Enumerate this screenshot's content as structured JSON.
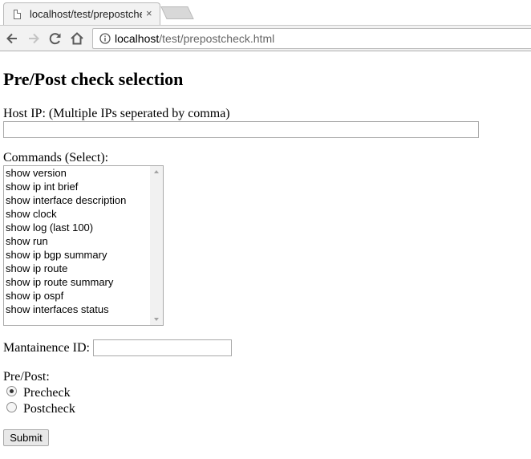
{
  "browser": {
    "tab_title": "localhost/test/prepostche",
    "tab_close": "×",
    "url_host": "localhost",
    "url_path": "/test/prepostcheck.html",
    "icons": [
      "page-icon",
      "back-arrow-icon",
      "forward-arrow-icon",
      "reload-icon",
      "home-icon",
      "info-icon"
    ]
  },
  "page": {
    "title": "Pre/Post check selection",
    "host_ip_label": "Host IP: (Multiple IPs seperated by comma)",
    "host_ip_value": "",
    "commands_label": "Commands (Select):",
    "commands": [
      "show version",
      "show ip int brief",
      "show interface description",
      "show clock",
      "show log (last 100)",
      "show run",
      "show ip bgp summary",
      "show ip route",
      "show ip route summary",
      "show ip ospf",
      "show interfaces status"
    ],
    "maintenance_label": "Mantainence ID:",
    "maintenance_value": "",
    "prepost_label": "Pre/Post:",
    "precheck_label": "Precheck",
    "postcheck_label": "Postcheck",
    "selected_option": "Precheck",
    "submit_label": "Submit"
  }
}
